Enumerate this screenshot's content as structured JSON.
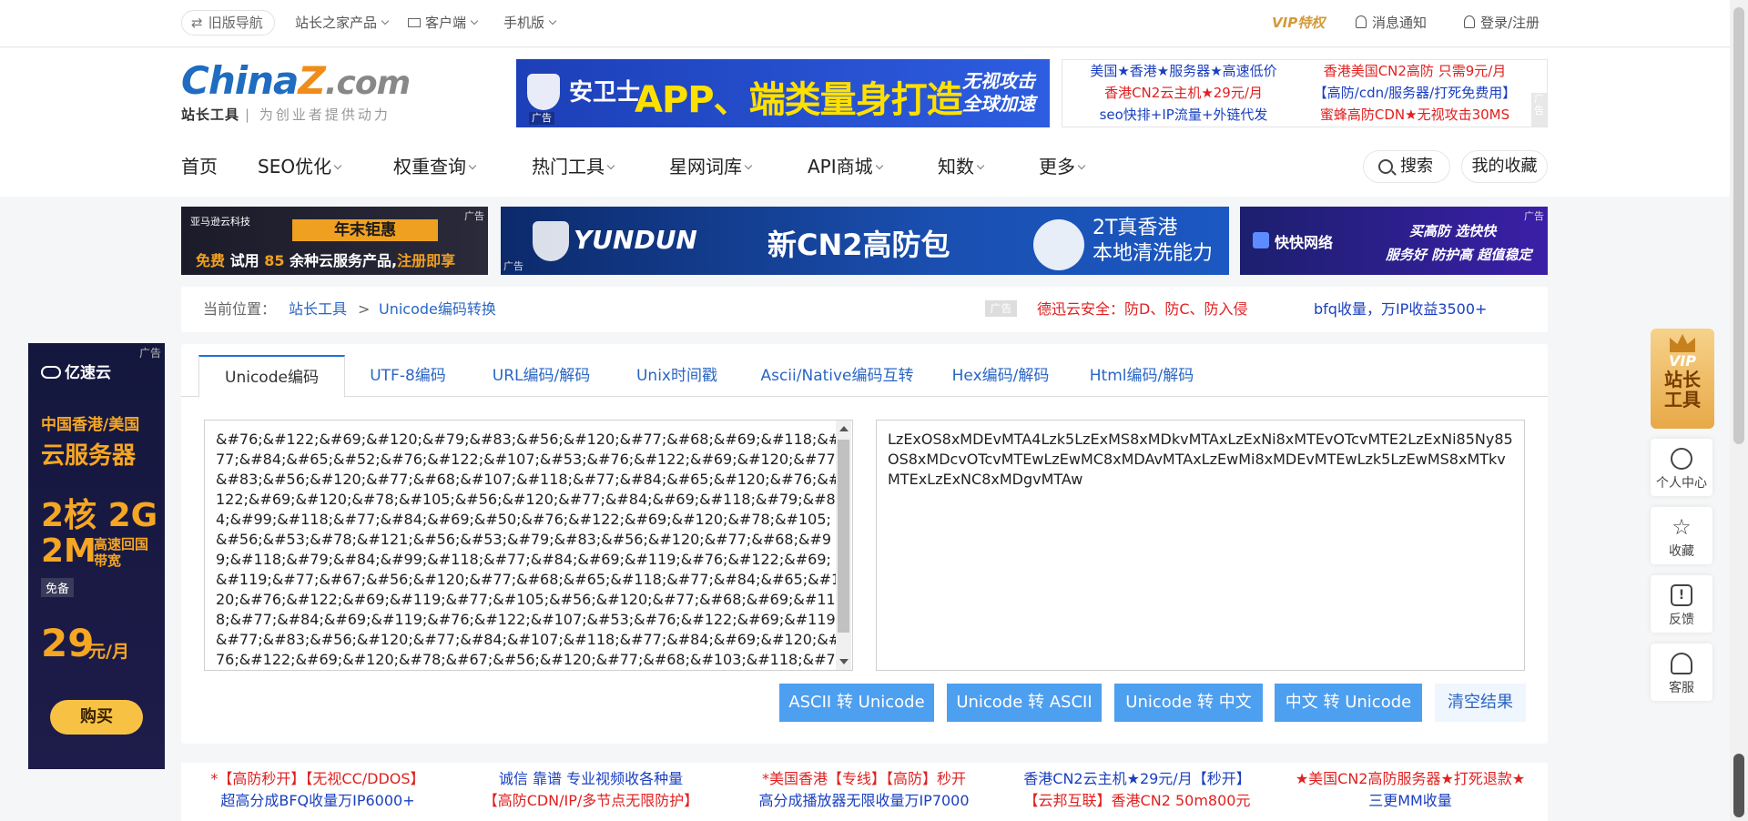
{
  "topbar": {
    "old_nav": "旧版导航",
    "products": "站长之家产品",
    "client": "客户端",
    "mobile": "手机版",
    "vip": "VIP特权",
    "notify": "消息通知",
    "login": "登录/注册"
  },
  "logo": {
    "brand_a": "China",
    "brand_z": "Z",
    "brand_b": ".com",
    "sub_bold": "站长工具",
    "sub": "为创业者提供动力"
  },
  "ad_top": {
    "t1": "安卫士",
    "t2": "APP、端类量身打造",
    "t3a": "无视攻击",
    "t3b": "全球加速",
    "tag": "广告"
  },
  "ad_links": [
    {
      "text": "美国★香港★服务器★高速低价",
      "color": "#1a3fbf"
    },
    {
      "text": "香港美国CN2高防 只需9元/月",
      "color": "#e02020"
    },
    {
      "text": "香港CN2云主机★29元/月",
      "color": "#e02020"
    },
    {
      "text": "【高防/cdn/服务器/打死免费用】",
      "color": "#1a3fbf"
    },
    {
      "text": "seo快排+IP流量+外链代发",
      "color": "#1a3fbf"
    },
    {
      "text": "蜜蜂高防CDN★无视攻击30MS",
      "color": "#e02020"
    }
  ],
  "ad_links_tag": "广告",
  "nav": [
    "首页",
    "SEO优化",
    "权重查询",
    "热门工具",
    "星网词库",
    "API商城",
    "知数",
    "更多"
  ],
  "search_label": "搜索",
  "fav_label": "我的收藏",
  "banners": {
    "b1_brand": "亚马逊云科技",
    "b1_title": "年末钜惠",
    "b1_free": "免费",
    "b1_trial": "试用",
    "b1_num": "85",
    "b1_rest": "余种云服务产品,",
    "b1_cta": "注册即享",
    "b2_brand": "YUNDUN",
    "b2_main": "新CN2高防包",
    "b2_r1": "2T真香港",
    "b2_r2": "本地清洗能力",
    "b3_brand": "快快网络",
    "b3_r1": "买高防 选快快",
    "b3_r2": "服务好 防护高 超值稳定",
    "tag": "广告"
  },
  "breadcrumb": {
    "label": "当前位置：",
    "link1": "站长工具",
    "sep": ">",
    "link2": "Unicode编码转换",
    "ad_tag": "广告",
    "ad1": "德迅云安全：防D、防C、防入侵",
    "ad2": "bfq收量，万IP收益3500+"
  },
  "tabs": [
    "Unicode编码",
    "UTF-8编码",
    "URL编码/解码",
    "Unix时间戳",
    "Ascii/Native编码互转",
    "Hex编码/解码",
    "Html编码/解码"
  ],
  "input_text": "&#76;&#122;&#69;&#120;&#79;&#83;&#56;&#120;&#77;&#68;&#69;&#118;&#77;&#84;&#65;&#52;&#76;&#122;&#107;&#53;&#76;&#122;&#69;&#120;&#77;&#83;&#56;&#120;&#77;&#68;&#107;&#118;&#77;&#84;&#65;&#120;&#76;&#122;&#69;&#120;&#78;&#105;&#56;&#120;&#77;&#84;&#69;&#118;&#79;&#84;&#99;&#118;&#77;&#84;&#69;&#50;&#76;&#122;&#69;&#120;&#78;&#105;&#56;&#53;&#78;&#121;&#56;&#53;&#79;&#83;&#56;&#120;&#77;&#68;&#99;&#118;&#79;&#84;&#99;&#118;&#77;&#84;&#69;&#119;&#76;&#122;&#69;&#119;&#77;&#67;&#56;&#120;&#77;&#68;&#65;&#118;&#77;&#84;&#65;&#120;&#76;&#122;&#69;&#119;&#77;&#105;&#56;&#120;&#77;&#68;&#69;&#118;&#77;&#84;&#69;&#119;&#76;&#122;&#107;&#53;&#76;&#122;&#69;&#119;&#77;&#83;&#56;&#120;&#77;&#84;&#107;&#118;&#77;&#84;&#69;&#120;&#76;&#122;&#69;&#120;&#78;&#67;&#56;&#120;&#77;&#68;&#103;&#118;&#77;&#84;&#65;&#119",
  "output_text": "LzExOS8xMDEvMTA4Lzk5LzExMS8xMDkvMTAxLzExNi8xMTEvOTcvMTE2LzExNi85Ny85OS8xMDcvOTcvMTEwLzEwMC8xMDAvMTAxLzEwMi8xMDEvMTEwLzk5LzEwMS8xMTkvMTExLzExNC8xMDgvMTAw",
  "buttons": [
    "ASCII 转 Unicode",
    "Unicode 转 ASCII",
    "Unicode 转 中文",
    "中文 转 Unicode",
    "清空结果"
  ],
  "left_ad": {
    "brand": "亿速云",
    "l1": "中国香港/美国",
    "l2": "云服务器",
    "l3": "2核 2G",
    "l4": "2M",
    "l4b": "高速回国带宽",
    "free": "免备",
    "price": "29",
    "unit": "元/月",
    "buy": "购买",
    "tag": "广告"
  },
  "side": {
    "vip_l1": "VIP",
    "vip_l2": "站长",
    "vip_l3": "工具",
    "center": "个人中心",
    "collect": "收藏",
    "feedback": "反馈",
    "service": "客服"
  },
  "bottom_links": [
    {
      "text": "*【高防秒开】【无视CC/DDOS】",
      "color": "#e02020"
    },
    {
      "text": "诚信 靠谱 专业视频收各种量",
      "color": "#1a3fbf"
    },
    {
      "text": "*美国香港【专线】【高防】秒开",
      "color": "#e02020"
    },
    {
      "text": "香港CN2云主机★29元/月【秒开】",
      "color": "#1a3fbf"
    },
    {
      "text": "★美国CN2高防服务器★打死退款★",
      "color": "#e02020"
    },
    {
      "text": "超高分成BFQ收量万IP6000+",
      "color": "#1a3fbf"
    },
    {
      "text": "【高防CDN/IP/多节点无限防护】",
      "color": "#e02020"
    },
    {
      "text": "高分成播放器无限收量万IP7000",
      "color": "#1a3fbf"
    },
    {
      "text": "【云邦互联】香港CN2 50m800元",
      "color": "#e02020"
    },
    {
      "text": "三更MM收量",
      "color": "#1a3fbf"
    }
  ]
}
